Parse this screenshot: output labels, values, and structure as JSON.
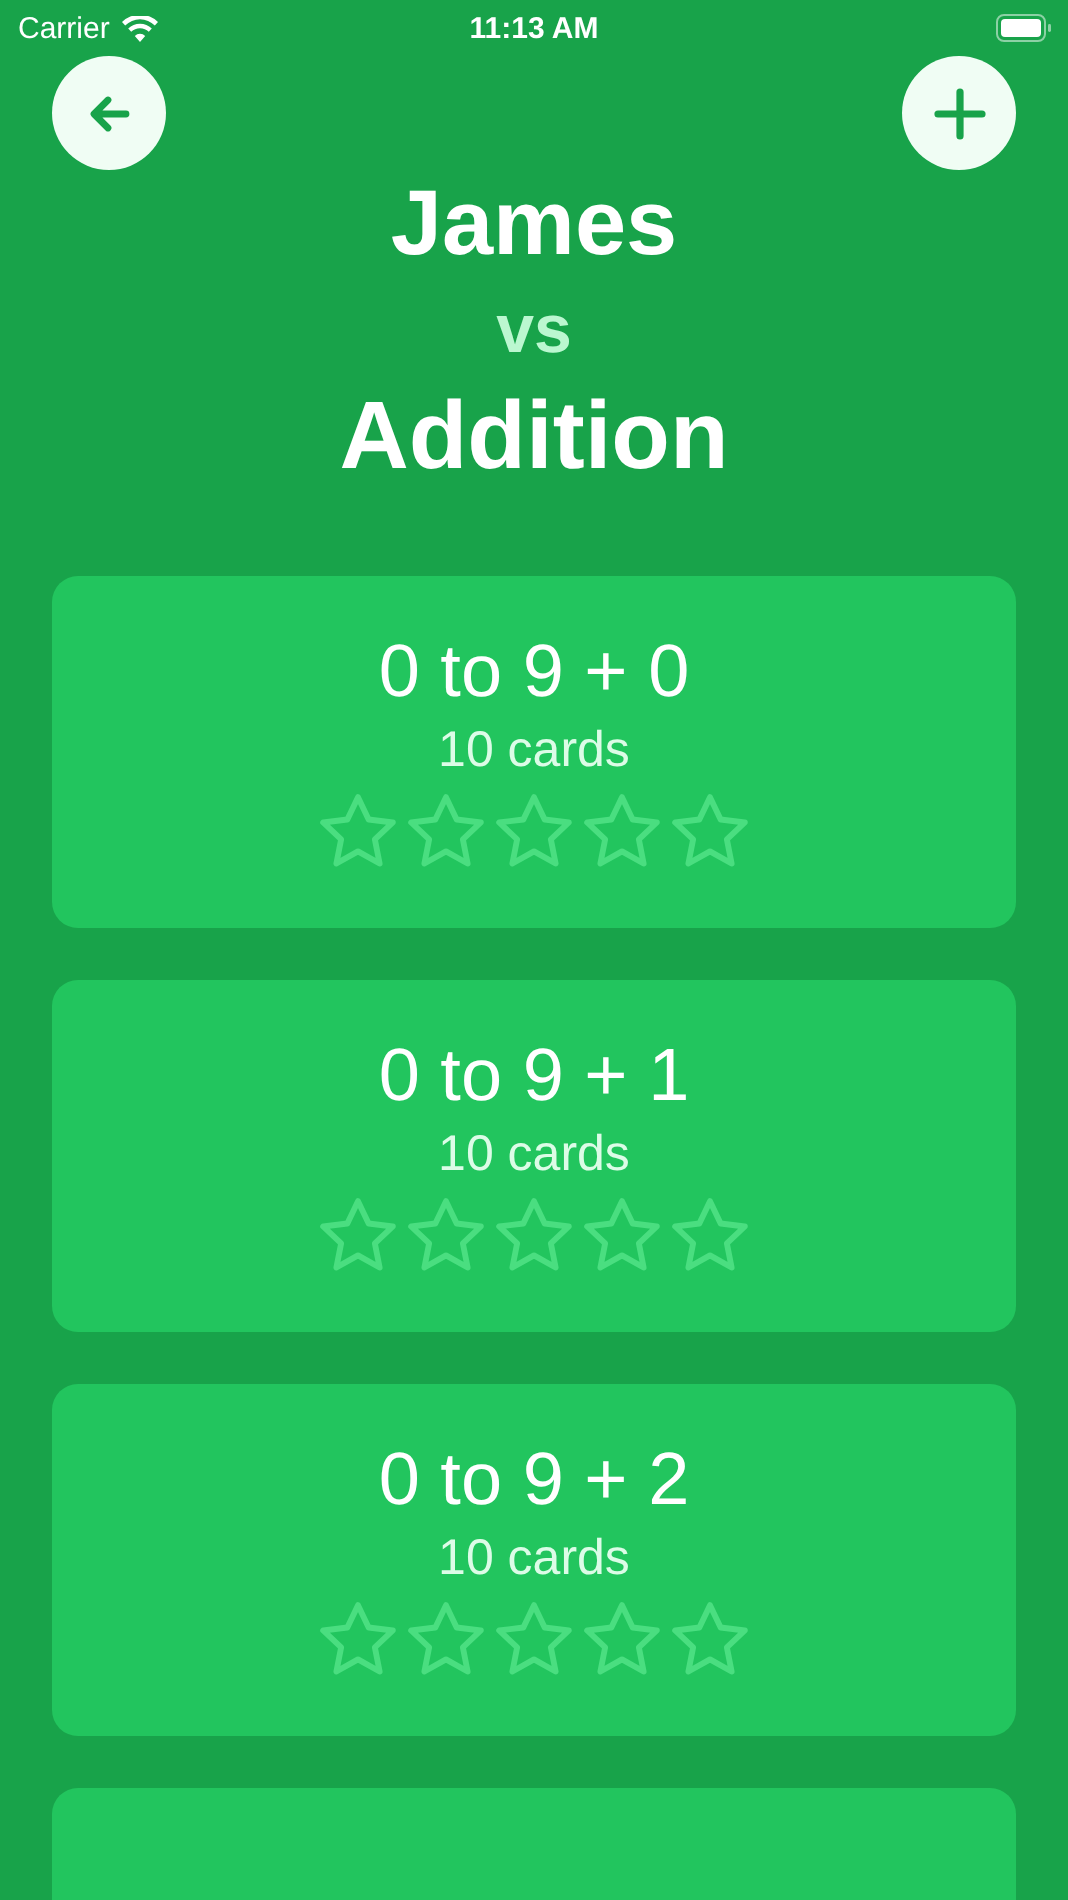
{
  "status_bar": {
    "carrier": "Carrier",
    "time": "11:13 AM"
  },
  "header": {
    "player": "James",
    "versus": "vs",
    "topic": "Addition"
  },
  "decks": [
    {
      "title": "0 to 9 + 0",
      "count": "10 cards",
      "stars": 0
    },
    {
      "title": "0 to 9 + 1",
      "count": "10 cards",
      "stars": 0
    },
    {
      "title": "0 to 9 + 2",
      "count": "10 cards",
      "stars": 0
    },
    {
      "kind": "cut"
    }
  ]
}
